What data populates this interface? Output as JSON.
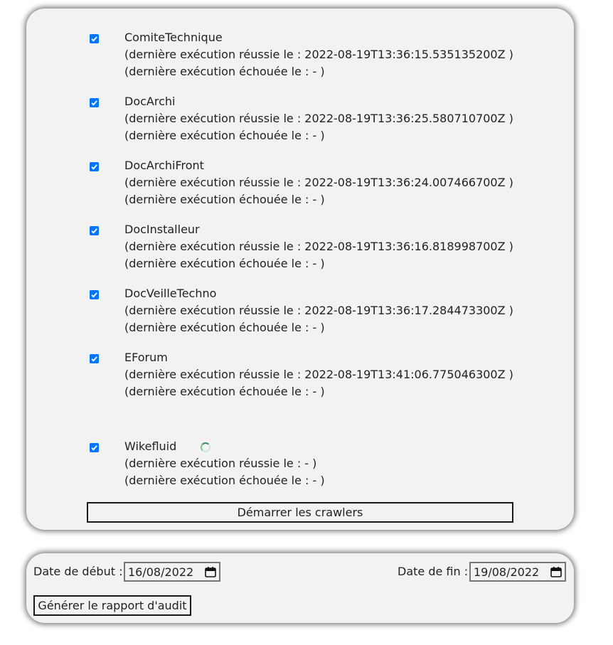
{
  "crawlers": [
    {
      "name": "ComiteTechnique",
      "success": "(dernière exécution réussie le : 2022-08-19T13:36:15.535135200Z )",
      "failure": "(dernière exécution échouée le : - )",
      "checked": true
    },
    {
      "name": "DocArchi",
      "success": "(dernière exécution réussie le : 2022-08-19T13:36:25.580710700Z )",
      "failure": "(dernière exécution échouée le : - )",
      "checked": true
    },
    {
      "name": "DocArchiFront",
      "success": "(dernière exécution réussie le : 2022-08-19T13:36:24.007466700Z )",
      "failure": "(dernière exécution échouée le : - )",
      "checked": true
    },
    {
      "name": "DocInstalleur",
      "success": "(dernière exécution réussie le : 2022-08-19T13:36:16.818998700Z )",
      "failure": "(dernière exécution échouée le : - )",
      "checked": true
    },
    {
      "name": "DocVeilleTechno",
      "success": "(dernière exécution réussie le : 2022-08-19T13:36:17.284473300Z )",
      "failure": "(dernière exécution échouée le : - )",
      "checked": true
    },
    {
      "name": "EForum",
      "success": "(dernière exécution réussie le : 2022-08-19T13:41:06.775046300Z )",
      "failure": "(dernière exécution échouée le : - )",
      "checked": true
    },
    {
      "name": "Wikefluid",
      "success": "(dernière exécution réussie le : - )",
      "failure": "(dernière exécution échouée le : - )",
      "checked": true,
      "running": true
    }
  ],
  "start_button_label": "Démarrer les crawlers",
  "audit": {
    "start_label": "Date de début :",
    "start_value": "16/08/2022",
    "end_label": "Date de fin :",
    "end_value": "19/08/2022",
    "report_button_label": "Générer le rapport d'audit"
  },
  "colors": {
    "panel_bg": "#f2f2f2",
    "checkbox_accent": "#0075ff",
    "spinner": "#3a8f5c"
  },
  "icons": {
    "checkbox": "checkbox-checked-icon",
    "spinner": "loading-spinner-icon",
    "calendar": "calendar-icon"
  }
}
